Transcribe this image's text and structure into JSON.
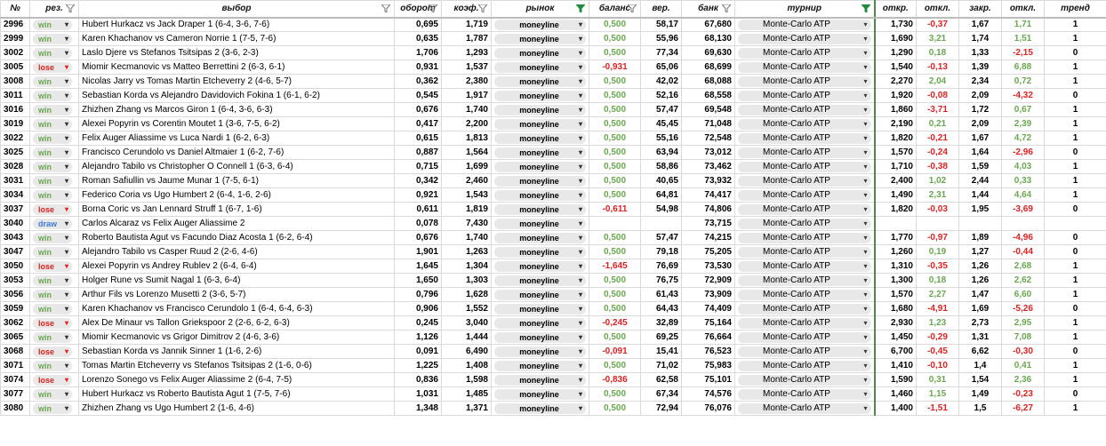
{
  "headers": [
    {
      "key": "id",
      "label": "№",
      "filter": false
    },
    {
      "key": "res",
      "label": "рез.",
      "filter": true
    },
    {
      "key": "pick",
      "label": "выбор",
      "filter": true
    },
    {
      "key": "turnover",
      "label": "оборот",
      "filter": true
    },
    {
      "key": "coef",
      "label": "коэф.",
      "filter": true
    },
    {
      "key": "market",
      "label": "рынок",
      "filter": true,
      "filter_active": true
    },
    {
      "key": "balance",
      "label": "баланс",
      "filter": true
    },
    {
      "key": "prob",
      "label": "вер.",
      "filter": false
    },
    {
      "key": "bank",
      "label": "банк",
      "filter": true
    },
    {
      "key": "tournament",
      "label": "турнир",
      "filter": true,
      "filter_active": true
    },
    {
      "key": "open",
      "label": "откр.",
      "filter": false
    },
    {
      "key": "dev1",
      "label": "откл.",
      "filter": false
    },
    {
      "key": "close",
      "label": "закр.",
      "filter": false
    },
    {
      "key": "dev2",
      "label": "откл.",
      "filter": false
    },
    {
      "key": "trend",
      "label": "тренд",
      "filter": false
    }
  ],
  "icons": {
    "filter": "filter-icon",
    "dropdown": "dropdown-arrow-icon"
  },
  "colors": {
    "win": "#6aa84f",
    "lose": "#e02020",
    "draw": "#3c78d8",
    "positive": "#6aa84f",
    "negative": "#e02020"
  },
  "rows": [
    {
      "id": "2996",
      "res": "win",
      "pick": "Hubert Hurkacz vs Jack Draper 1 (6-4, 3-6, 7-6)",
      "turnover": "0,695",
      "coef": "1,719",
      "market": "moneyline",
      "balance": "0,500",
      "prob": "58,17",
      "bank": "67,680",
      "tournament": "Monte-Carlo ATP",
      "open": "1,730",
      "dev1": "-0,37",
      "close": "1,67",
      "dev2": "1,71",
      "trend": "1"
    },
    {
      "id": "2999",
      "res": "win",
      "pick": "Karen Khachanov vs Cameron Norrie 1 (7-5, 7-6)",
      "turnover": "0,635",
      "coef": "1,787",
      "market": "moneyline",
      "balance": "0,500",
      "prob": "55,96",
      "bank": "68,130",
      "tournament": "Monte-Carlo ATP",
      "open": "1,690",
      "dev1": "3,21",
      "close": "1,74",
      "dev2": "1,51",
      "trend": "1"
    },
    {
      "id": "3002",
      "res": "win",
      "pick": "Laslo Djere vs Stefanos Tsitsipas 2 (3-6, 2-3)",
      "turnover": "1,706",
      "coef": "1,293",
      "market": "moneyline",
      "balance": "0,500",
      "prob": "77,34",
      "bank": "69,630",
      "tournament": "Monte-Carlo ATP",
      "open": "1,290",
      "dev1": "0,18",
      "close": "1,33",
      "dev2": "-2,15",
      "trend": "0"
    },
    {
      "id": "3005",
      "res": "lose",
      "pick": "Miomir Kecmanovic vs Matteo Berrettini 2 (6-3, 6-1)",
      "turnover": "0,931",
      "coef": "1,537",
      "market": "moneyline",
      "balance": "-0,931",
      "prob": "65,06",
      "bank": "68,699",
      "tournament": "Monte-Carlo ATP",
      "open": "1,540",
      "dev1": "-0,13",
      "close": "1,39",
      "dev2": "6,88",
      "trend": "1"
    },
    {
      "id": "3008",
      "res": "win",
      "pick": "Nicolas Jarry vs Tomas Martin Etcheverry 2 (4-6, 5-7)",
      "turnover": "0,362",
      "coef": "2,380",
      "market": "moneyline",
      "balance": "0,500",
      "prob": "42,02",
      "bank": "68,088",
      "tournament": "Monte-Carlo ATP",
      "open": "2,270",
      "dev1": "2,04",
      "close": "2,34",
      "dev2": "0,72",
      "trend": "1"
    },
    {
      "id": "3011",
      "res": "win",
      "pick": "Sebastian Korda vs Alejandro Davidovich Fokina 1 (6-1, 6-2)",
      "turnover": "0,545",
      "coef": "1,917",
      "market": "moneyline",
      "balance": "0,500",
      "prob": "52,16",
      "bank": "68,558",
      "tournament": "Monte-Carlo ATP",
      "open": "1,920",
      "dev1": "-0,08",
      "close": "2,09",
      "dev2": "-4,32",
      "trend": "0"
    },
    {
      "id": "3016",
      "res": "win",
      "pick": "Zhizhen Zhang vs Marcos Giron 1 (6-4, 3-6, 6-3)",
      "turnover": "0,676",
      "coef": "1,740",
      "market": "moneyline",
      "balance": "0,500",
      "prob": "57,47",
      "bank": "69,548",
      "tournament": "Monte-Carlo ATP",
      "open": "1,860",
      "dev1": "-3,71",
      "close": "1,72",
      "dev2": "0,67",
      "trend": "1"
    },
    {
      "id": "3019",
      "res": "win",
      "pick": "Alexei Popyrin vs Corentin Moutet 1 (3-6, 7-5, 6-2)",
      "turnover": "0,417",
      "coef": "2,200",
      "market": "moneyline",
      "balance": "0,500",
      "prob": "45,45",
      "bank": "71,048",
      "tournament": "Monte-Carlo ATP",
      "open": "2,190",
      "dev1": "0,21",
      "close": "2,09",
      "dev2": "2,39",
      "trend": "1"
    },
    {
      "id": "3022",
      "res": "win",
      "pick": "Felix Auger Aliassime vs Luca Nardi 1 (6-2, 6-3)",
      "turnover": "0,615",
      "coef": "1,813",
      "market": "moneyline",
      "balance": "0,500",
      "prob": "55,16",
      "bank": "72,548",
      "tournament": "Monte-Carlo ATP",
      "open": "1,820",
      "dev1": "-0,21",
      "close": "1,67",
      "dev2": "4,72",
      "trend": "1"
    },
    {
      "id": "3025",
      "res": "win",
      "pick": "Francisco Cerundolo vs Daniel Altmaier 1 (6-2, 7-6)",
      "turnover": "0,887",
      "coef": "1,564",
      "market": "moneyline",
      "balance": "0,500",
      "prob": "63,94",
      "bank": "73,012",
      "tournament": "Monte-Carlo ATP",
      "open": "1,570",
      "dev1": "-0,24",
      "close": "1,64",
      "dev2": "-2,96",
      "trend": "0"
    },
    {
      "id": "3028",
      "res": "win",
      "pick": "Alejandro Tabilo vs Christopher O Connell 1 (6-3, 6-4)",
      "turnover": "0,715",
      "coef": "1,699",
      "market": "moneyline",
      "balance": "0,500",
      "prob": "58,86",
      "bank": "73,462",
      "tournament": "Monte-Carlo ATP",
      "open": "1,710",
      "dev1": "-0,38",
      "close": "1,59",
      "dev2": "4,03",
      "trend": "1"
    },
    {
      "id": "3031",
      "res": "win",
      "pick": "Roman Safiullin vs Jaume Munar 1 (7-5, 6-1)",
      "turnover": "0,342",
      "coef": "2,460",
      "market": "moneyline",
      "balance": "0,500",
      "prob": "40,65",
      "bank": "73,932",
      "tournament": "Monte-Carlo ATP",
      "open": "2,400",
      "dev1": "1,02",
      "close": "2,44",
      "dev2": "0,33",
      "trend": "1"
    },
    {
      "id": "3034",
      "res": "win",
      "pick": "Federico Coria vs Ugo Humbert 2 (6-4, 1-6, 2-6)",
      "turnover": "0,921",
      "coef": "1,543",
      "market": "moneyline",
      "balance": "0,500",
      "prob": "64,81",
      "bank": "74,417",
      "tournament": "Monte-Carlo ATP",
      "open": "1,490",
      "dev1": "2,31",
      "close": "1,44",
      "dev2": "4,64",
      "trend": "1"
    },
    {
      "id": "3037",
      "res": "lose",
      "pick": "Borna Coric vs Jan Lennard Struff 1 (6-7, 1-6)",
      "turnover": "0,611",
      "coef": "1,819",
      "market": "moneyline",
      "balance": "-0,611",
      "prob": "54,98",
      "bank": "74,806",
      "tournament": "Monte-Carlo ATP",
      "open": "1,820",
      "dev1": "-0,03",
      "close": "1,95",
      "dev2": "-3,69",
      "trend": "0"
    },
    {
      "id": "3040",
      "res": "draw",
      "pick": "Carlos Alcaraz vs Felix Auger Aliassime 2",
      "turnover": "0,078",
      "coef": "7,430",
      "market": "moneyline",
      "balance": "",
      "prob": "",
      "bank": "73,715",
      "tournament": "Monte-Carlo ATP",
      "open": "",
      "dev1": "",
      "close": "",
      "dev2": "",
      "trend": ""
    },
    {
      "id": "3043",
      "res": "win",
      "pick": "Roberto Bautista Agut vs Facundo Diaz Acosta 1 (6-2, 6-4)",
      "turnover": "0,676",
      "coef": "1,740",
      "market": "moneyline",
      "balance": "0,500",
      "prob": "57,47",
      "bank": "74,215",
      "tournament": "Monte-Carlo ATP",
      "open": "1,770",
      "dev1": "-0,97",
      "close": "1,89",
      "dev2": "-4,96",
      "trend": "0"
    },
    {
      "id": "3047",
      "res": "win",
      "pick": "Alejandro Tabilo vs Casper Ruud 2 (2-6, 4-6)",
      "turnover": "1,901",
      "coef": "1,263",
      "market": "moneyline",
      "balance": "0,500",
      "prob": "79,18",
      "bank": "75,205",
      "tournament": "Monte-Carlo ATP",
      "open": "1,260",
      "dev1": "0,19",
      "close": "1,27",
      "dev2": "-0,44",
      "trend": "0"
    },
    {
      "id": "3050",
      "res": "lose",
      "pick": "Alexei Popyrin vs Andrey Rublev 2 (6-4, 6-4)",
      "turnover": "1,645",
      "coef": "1,304",
      "market": "moneyline",
      "balance": "-1,645",
      "prob": "76,69",
      "bank": "73,530",
      "tournament": "Monte-Carlo ATP",
      "open": "1,310",
      "dev1": "-0,35",
      "close": "1,26",
      "dev2": "2,68",
      "trend": "1"
    },
    {
      "id": "3053",
      "res": "win",
      "pick": "Holger Rune vs Sumit Nagal 1 (6-3, 6-4)",
      "turnover": "1,650",
      "coef": "1,303",
      "market": "moneyline",
      "balance": "0,500",
      "prob": "76,75",
      "bank": "72,909",
      "tournament": "Monte-Carlo ATP",
      "open": "1,300",
      "dev1": "0,18",
      "close": "1,26",
      "dev2": "2,62",
      "trend": "1"
    },
    {
      "id": "3056",
      "res": "win",
      "pick": "Arthur Fils vs Lorenzo Musetti 2 (3-6, 5-7)",
      "turnover": "0,796",
      "coef": "1,628",
      "market": "moneyline",
      "balance": "0,500",
      "prob": "61,43",
      "bank": "73,909",
      "tournament": "Monte-Carlo ATP",
      "open": "1,570",
      "dev1": "2,27",
      "close": "1,47",
      "dev2": "6,60",
      "trend": "1"
    },
    {
      "id": "3059",
      "res": "win",
      "pick": "Karen Khachanov vs Francisco Cerundolo 1 (6-4, 6-4, 6-3)",
      "turnover": "0,906",
      "coef": "1,552",
      "market": "moneyline",
      "balance": "0,500",
      "prob": "64,43",
      "bank": "74,409",
      "tournament": "Monte-Carlo ATP",
      "open": "1,680",
      "dev1": "-4,91",
      "close": "1,69",
      "dev2": "-5,26",
      "trend": "0"
    },
    {
      "id": "3062",
      "res": "lose",
      "pick": "Alex De Minaur vs Tallon Griekspoor 2 (2-6, 6-2, 6-3)",
      "turnover": "0,245",
      "coef": "3,040",
      "market": "moneyline",
      "balance": "-0,245",
      "prob": "32,89",
      "bank": "75,164",
      "tournament": "Monte-Carlo ATP",
      "open": "2,930",
      "dev1": "1,23",
      "close": "2,73",
      "dev2": "2,95",
      "trend": "1"
    },
    {
      "id": "3065",
      "res": "win",
      "pick": "Miomir Kecmanovic vs Grigor Dimitrov 2 (4-6, 3-6)",
      "turnover": "1,126",
      "coef": "1,444",
      "market": "moneyline",
      "balance": "0,500",
      "prob": "69,25",
      "bank": "76,664",
      "tournament": "Monte-Carlo ATP",
      "open": "1,450",
      "dev1": "-0,29",
      "close": "1,31",
      "dev2": "7,08",
      "trend": "1"
    },
    {
      "id": "3068",
      "res": "lose",
      "pick": "Sebastian Korda vs Jannik Sinner 1 (1-6, 2-6)",
      "turnover": "0,091",
      "coef": "6,490",
      "market": "moneyline",
      "balance": "-0,091",
      "prob": "15,41",
      "bank": "76,523",
      "tournament": "Monte-Carlo ATP",
      "open": "6,700",
      "dev1": "-0,45",
      "close": "6,62",
      "dev2": "-0,30",
      "trend": "0"
    },
    {
      "id": "3071",
      "res": "win",
      "pick": "Tomas Martin Etcheverry vs Stefanos Tsitsipas 2 (1-6, 0-6)",
      "turnover": "1,225",
      "coef": "1,408",
      "market": "moneyline",
      "balance": "0,500",
      "prob": "71,02",
      "bank": "75,983",
      "tournament": "Monte-Carlo ATP",
      "open": "1,410",
      "dev1": "-0,10",
      "close": "1,4",
      "dev2": "0,41",
      "trend": "1"
    },
    {
      "id": "3074",
      "res": "lose",
      "pick": "Lorenzo Sonego vs Felix Auger Aliassime 2 (6-4, 7-5)",
      "turnover": "0,836",
      "coef": "1,598",
      "market": "moneyline",
      "balance": "-0,836",
      "prob": "62,58",
      "bank": "75,101",
      "tournament": "Monte-Carlo ATP",
      "open": "1,590",
      "dev1": "0,31",
      "close": "1,54",
      "dev2": "2,36",
      "trend": "1"
    },
    {
      "id": "3077",
      "res": "win",
      "pick": "Hubert Hurkacz vs Roberto Bautista Agut 1 (7-5, 7-6)",
      "turnover": "1,031",
      "coef": "1,485",
      "market": "moneyline",
      "balance": "0,500",
      "prob": "67,34",
      "bank": "74,576",
      "tournament": "Monte-Carlo ATP",
      "open": "1,460",
      "dev1": "1,15",
      "close": "1,49",
      "dev2": "-0,23",
      "trend": "0"
    },
    {
      "id": "3080",
      "res": "win",
      "pick": "Zhizhen Zhang vs Ugo Humbert 2 (1-6, 4-6)",
      "turnover": "1,348",
      "coef": "1,371",
      "market": "moneyline",
      "balance": "0,500",
      "prob": "72,94",
      "bank": "76,076",
      "tournament": "Monte-Carlo ATP",
      "open": "1,400",
      "dev1": "-1,51",
      "close": "1,5",
      "dev2": "-6,27",
      "trend": "1"
    }
  ]
}
